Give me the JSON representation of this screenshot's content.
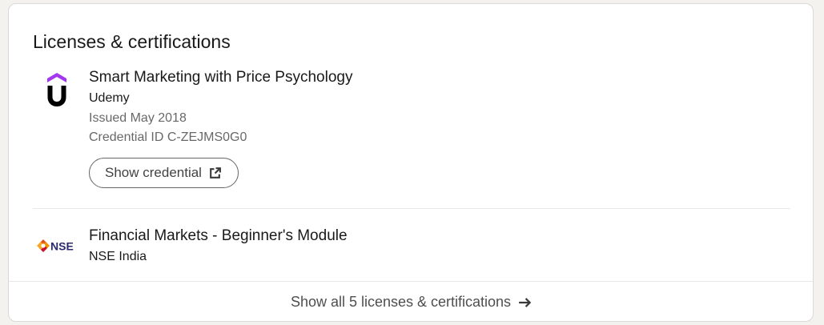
{
  "section": {
    "title": "Licenses & certifications"
  },
  "items": [
    {
      "title": "Smart Marketing with Price Psychology",
      "issuer": "Udemy",
      "issued": "Issued May 2018",
      "credential_id": "Credential ID C-ZEJMS0G0",
      "button_label": "Show credential",
      "logo_icon": "udemy-logo",
      "logo_color": "#a435f0"
    },
    {
      "title": "Financial Markets - Beginner's Module",
      "issuer": "NSE India",
      "logo_icon": "nse-logo",
      "logo_text": "NSE",
      "logo_color": "#2b2a6e",
      "logo_accent": "#e2541b"
    }
  ],
  "footer": {
    "link_label": "Show all 5 licenses & certifications",
    "arrow_icon": "arrow-right-icon"
  },
  "icons": {
    "external_link": "external-link-icon"
  }
}
